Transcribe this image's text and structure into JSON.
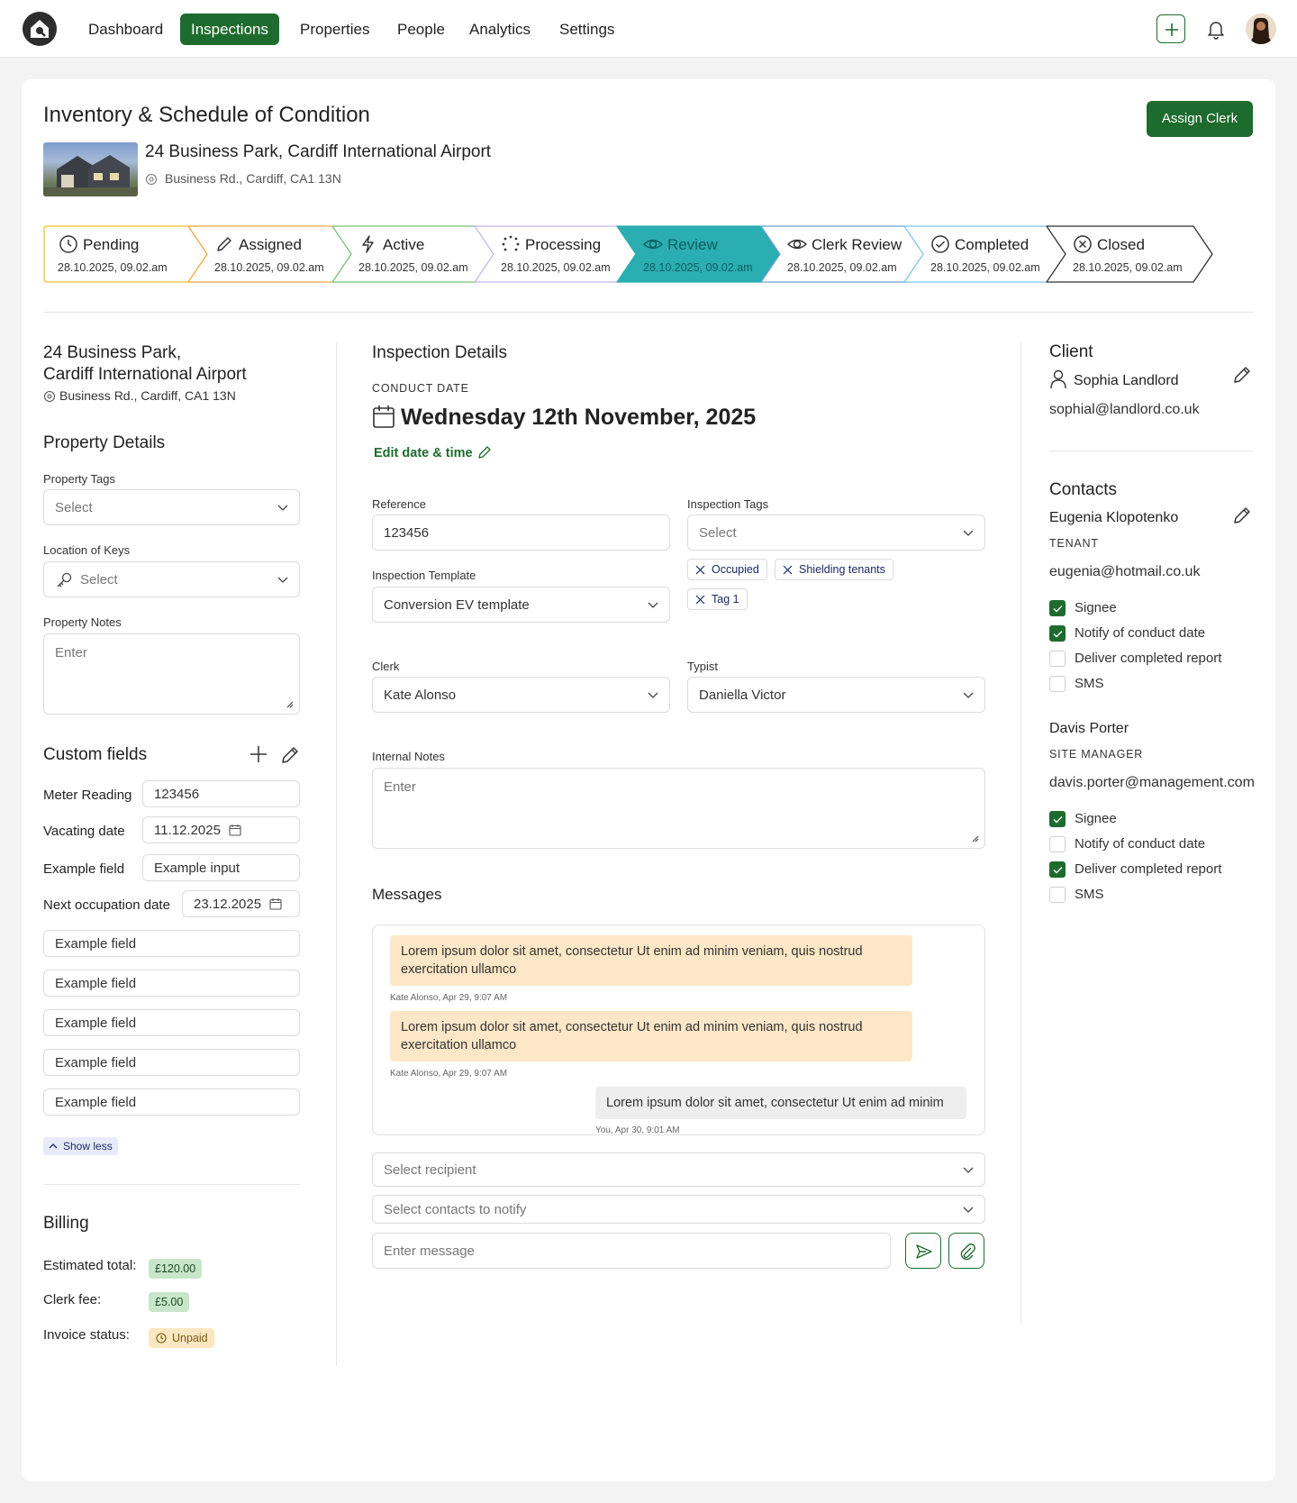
{
  "nav": {
    "items": [
      "Dashboard",
      "Inspections",
      "Properties",
      "People",
      "Analytics",
      "Settings"
    ],
    "active_index": 1
  },
  "header": {
    "title": "Inventory & Schedule of Condition",
    "assign_label": "Assign Clerk",
    "property_name": "24 Business Park, Cardiff International Airport",
    "address": "Business Rd., Cardiff, CA1 13N"
  },
  "stages": [
    {
      "label": "Pending",
      "date": "28.10.2025, 09.02.am",
      "color": "#f2c230",
      "icon": "clock-icon"
    },
    {
      "label": "Assigned",
      "date": "28.10.2025, 09.02.am",
      "color": "#f2a93a",
      "icon": "pencil-icon"
    },
    {
      "label": "Active",
      "date": "28.10.2025, 09.02.am",
      "color": "#79c27a",
      "icon": "lightning-icon"
    },
    {
      "label": "Processing",
      "date": "28.10.2025, 09.02.am",
      "color": "#c9b6e6",
      "icon": "spinner-icon"
    },
    {
      "label": "Review",
      "date": "28.10.2025, 09.02.am",
      "color": "#2aaeb1",
      "icon": "eye-icon"
    },
    {
      "label": "Clerk Review",
      "date": "28.10.2025, 09.02.am",
      "color": "#6fa2d8",
      "icon": "eye-icon"
    },
    {
      "label": "Completed",
      "date": "28.10.2025, 09.02.am",
      "color": "#7cc8ea",
      "icon": "check-circle-icon"
    },
    {
      "label": "Closed",
      "date": "28.10.2025, 09.02.am",
      "color": "#333333",
      "icon": "x-circle-icon"
    }
  ],
  "left": {
    "property_line1": "24 Business Park,",
    "property_line2": "Cardiff International Airport",
    "address": "Business Rd., Cardiff, CA1 13N",
    "property_details_title": "Property Details",
    "property_tags_label": "Property Tags",
    "property_tags_placeholder": "Select",
    "keys_label": "Location of Keys",
    "keys_placeholder": "Select",
    "notes_label": "Property Notes",
    "notes_placeholder": "Enter",
    "custom_fields_title": "Custom fields",
    "custom_fields": [
      {
        "label": "Meter Reading",
        "value": "123456"
      },
      {
        "label": "Vacating date",
        "value": "11.12.2025"
      },
      {
        "label": "Example field",
        "value": "Example input"
      },
      {
        "label": "Next occupation date",
        "value": "23.12.2025"
      }
    ],
    "extra_fields": [
      "Example field",
      "Example field",
      "Example field",
      "Example field",
      "Example field"
    ],
    "show_less": "Show less",
    "billing_title": "Billing",
    "billing": [
      {
        "label": "Estimated total:",
        "value": "£120.00"
      },
      {
        "label": "Clerk fee:",
        "value": "£5.00"
      },
      {
        "label": "Invoice status:",
        "value": "Unpaid"
      }
    ]
  },
  "middle": {
    "title": "Inspection Details",
    "conduct_label": "CONDUCT DATE",
    "conduct_date": "Wednesday 12th November, 2025",
    "edit_date": "Edit date & time",
    "reference_label": "Reference",
    "reference_value": "123456",
    "inspection_tags_label": "Inspection Tags",
    "inspection_tags_placeholder": "Select",
    "tags": [
      "Occupied",
      "Shielding tenants",
      "Tag 1"
    ],
    "template_label": "Inspection Template",
    "template_value": "Conversion EV template",
    "clerk_label": "Clerk",
    "clerk_value": "Kate Alonso",
    "typist_label": "Typist",
    "typist_value": "Daniella Victor",
    "internal_notes_label": "Internal Notes",
    "internal_notes_placeholder": "Enter",
    "messages_title": "Messages",
    "messages": [
      {
        "text": "Lorem ipsum dolor sit amet, consectetur Ut enim ad minim veniam, quis nostrud exercitation ullamco",
        "meta": "Kate Alonso,  Apr 29, 9:07 AM"
      },
      {
        "text": "Lorem ipsum dolor sit amet, consectetur Ut enim ad minim veniam, quis nostrud exercitation ullamco",
        "meta": "Kate Alonso,  Apr 29, 9:07 AM"
      },
      {
        "text": "Lorem ipsum dolor sit amet, consectetur Ut enim ad minim",
        "meta": "You,  Apr 30, 9:01 AM"
      }
    ],
    "recipient_placeholder": "Select recipient",
    "notify_placeholder": "Select contacts to notify",
    "message_placeholder": "Enter message"
  },
  "right": {
    "client_title": "Client",
    "client_name": "Sophia Landlord",
    "client_email": "sophial@landlord.co.uk",
    "contacts_title": "Contacts",
    "contacts": [
      {
        "name": "Eugenia Klopotenko",
        "role": "TENANT",
        "email": "eugenia@hotmail.co.uk",
        "options": [
          {
            "label": "Signee",
            "checked": true
          },
          {
            "label": "Notify of conduct date",
            "checked": true
          },
          {
            "label": "Deliver completed report",
            "checked": false
          },
          {
            "label": "SMS",
            "checked": false
          }
        ]
      },
      {
        "name": "Davis Porter",
        "role": "SITE MANAGER",
        "email": "davis.porter@management.com",
        "options": [
          {
            "label": "Signee",
            "checked": true
          },
          {
            "label": "Notify of conduct date",
            "checked": false
          },
          {
            "label": "Deliver completed report",
            "checked": true
          },
          {
            "label": "SMS",
            "checked": false
          }
        ]
      }
    ]
  }
}
